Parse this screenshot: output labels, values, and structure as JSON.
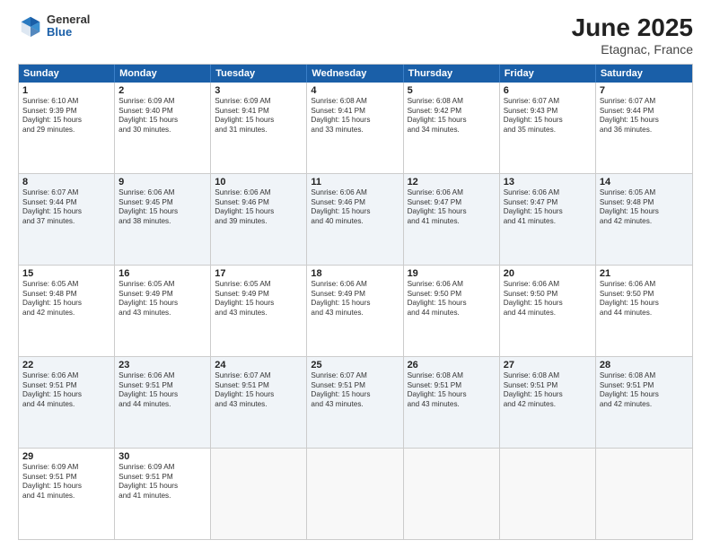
{
  "header": {
    "logo_general": "General",
    "logo_blue": "Blue",
    "title": "June 2025",
    "location": "Etagnac, France"
  },
  "weekdays": [
    "Sunday",
    "Monday",
    "Tuesday",
    "Wednesday",
    "Thursday",
    "Friday",
    "Saturday"
  ],
  "rows": [
    [
      {
        "day": "",
        "info": "",
        "empty": true
      },
      {
        "day": "2",
        "info": "Sunrise: 6:09 AM\nSunset: 9:40 PM\nDaylight: 15 hours\nand 30 minutes."
      },
      {
        "day": "3",
        "info": "Sunrise: 6:09 AM\nSunset: 9:41 PM\nDaylight: 15 hours\nand 31 minutes."
      },
      {
        "day": "4",
        "info": "Sunrise: 6:08 AM\nSunset: 9:41 PM\nDaylight: 15 hours\nand 33 minutes."
      },
      {
        "day": "5",
        "info": "Sunrise: 6:08 AM\nSunset: 9:42 PM\nDaylight: 15 hours\nand 34 minutes."
      },
      {
        "day": "6",
        "info": "Sunrise: 6:07 AM\nSunset: 9:43 PM\nDaylight: 15 hours\nand 35 minutes."
      },
      {
        "day": "7",
        "info": "Sunrise: 6:07 AM\nSunset: 9:44 PM\nDaylight: 15 hours\nand 36 minutes."
      }
    ],
    [
      {
        "day": "8",
        "info": "Sunrise: 6:07 AM\nSunset: 9:44 PM\nDaylight: 15 hours\nand 37 minutes.",
        "shaded": true
      },
      {
        "day": "9",
        "info": "Sunrise: 6:06 AM\nSunset: 9:45 PM\nDaylight: 15 hours\nand 38 minutes.",
        "shaded": true
      },
      {
        "day": "10",
        "info": "Sunrise: 6:06 AM\nSunset: 9:46 PM\nDaylight: 15 hours\nand 39 minutes.",
        "shaded": true
      },
      {
        "day": "11",
        "info": "Sunrise: 6:06 AM\nSunset: 9:46 PM\nDaylight: 15 hours\nand 40 minutes.",
        "shaded": true
      },
      {
        "day": "12",
        "info": "Sunrise: 6:06 AM\nSunset: 9:47 PM\nDaylight: 15 hours\nand 41 minutes.",
        "shaded": true
      },
      {
        "day": "13",
        "info": "Sunrise: 6:06 AM\nSunset: 9:47 PM\nDaylight: 15 hours\nand 41 minutes.",
        "shaded": true
      },
      {
        "day": "14",
        "info": "Sunrise: 6:05 AM\nSunset: 9:48 PM\nDaylight: 15 hours\nand 42 minutes.",
        "shaded": true
      }
    ],
    [
      {
        "day": "15",
        "info": "Sunrise: 6:05 AM\nSunset: 9:48 PM\nDaylight: 15 hours\nand 42 minutes."
      },
      {
        "day": "16",
        "info": "Sunrise: 6:05 AM\nSunset: 9:49 PM\nDaylight: 15 hours\nand 43 minutes."
      },
      {
        "day": "17",
        "info": "Sunrise: 6:05 AM\nSunset: 9:49 PM\nDaylight: 15 hours\nand 43 minutes."
      },
      {
        "day": "18",
        "info": "Sunrise: 6:06 AM\nSunset: 9:49 PM\nDaylight: 15 hours\nand 43 minutes."
      },
      {
        "day": "19",
        "info": "Sunrise: 6:06 AM\nSunset: 9:50 PM\nDaylight: 15 hours\nand 44 minutes."
      },
      {
        "day": "20",
        "info": "Sunrise: 6:06 AM\nSunset: 9:50 PM\nDaylight: 15 hours\nand 44 minutes."
      },
      {
        "day": "21",
        "info": "Sunrise: 6:06 AM\nSunset: 9:50 PM\nDaylight: 15 hours\nand 44 minutes."
      }
    ],
    [
      {
        "day": "22",
        "info": "Sunrise: 6:06 AM\nSunset: 9:51 PM\nDaylight: 15 hours\nand 44 minutes.",
        "shaded": true
      },
      {
        "day": "23",
        "info": "Sunrise: 6:06 AM\nSunset: 9:51 PM\nDaylight: 15 hours\nand 44 minutes.",
        "shaded": true
      },
      {
        "day": "24",
        "info": "Sunrise: 6:07 AM\nSunset: 9:51 PM\nDaylight: 15 hours\nand 43 minutes.",
        "shaded": true
      },
      {
        "day": "25",
        "info": "Sunrise: 6:07 AM\nSunset: 9:51 PM\nDaylight: 15 hours\nand 43 minutes.",
        "shaded": true
      },
      {
        "day": "26",
        "info": "Sunrise: 6:08 AM\nSunset: 9:51 PM\nDaylight: 15 hours\nand 43 minutes.",
        "shaded": true
      },
      {
        "day": "27",
        "info": "Sunrise: 6:08 AM\nSunset: 9:51 PM\nDaylight: 15 hours\nand 42 minutes.",
        "shaded": true
      },
      {
        "day": "28",
        "info": "Sunrise: 6:08 AM\nSunset: 9:51 PM\nDaylight: 15 hours\nand 42 minutes.",
        "shaded": true
      }
    ],
    [
      {
        "day": "29",
        "info": "Sunrise: 6:09 AM\nSunset: 9:51 PM\nDaylight: 15 hours\nand 41 minutes."
      },
      {
        "day": "30",
        "info": "Sunrise: 6:09 AM\nSunset: 9:51 PM\nDaylight: 15 hours\nand 41 minutes."
      },
      {
        "day": "",
        "info": "",
        "empty": true
      },
      {
        "day": "",
        "info": "",
        "empty": true
      },
      {
        "day": "",
        "info": "",
        "empty": true
      },
      {
        "day": "",
        "info": "",
        "empty": true
      },
      {
        "day": "",
        "info": "",
        "empty": true
      }
    ]
  ],
  "first_row": {
    "day1": {
      "day": "1",
      "info": "Sunrise: 6:10 AM\nSunset: 9:39 PM\nDaylight: 15 hours\nand 29 minutes."
    }
  }
}
